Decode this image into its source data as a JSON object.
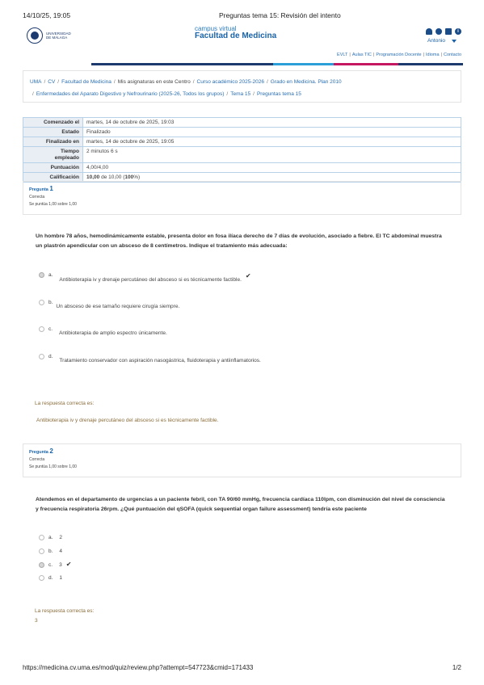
{
  "print": {
    "datetime": "14/10/25, 19:05",
    "doc_title": "Preguntas tema 15: Revisión del intento",
    "url": "https://medicina.cv.uma.es/mod/quiz/review.php?attempt=547723&cmid=171433",
    "page": "1/2"
  },
  "header": {
    "logo_text": "UNIVERSIDAD DE MÁLAGA",
    "brand_small": "campus virtual",
    "brand_big": "Facultad de Medicina",
    "user_name": "Antonio",
    "icons": [
      "bell-icon",
      "chat-icon",
      "mail-icon",
      "info-icon"
    ],
    "bar_colors": [
      "#1d3a6e",
      "#2a9fd8",
      "#c4175f"
    ]
  },
  "top_links": [
    "EVLT",
    "Aulas TIC",
    "Programación Docente",
    "Idioma",
    "Contacto"
  ],
  "breadcrumb": {
    "row1": [
      "UMA",
      "CV",
      "Facultad de Medicina",
      "Mis asignaturas en este Centro",
      "Curso académico 2025-2026",
      "Grado en Medicina. Plan 2010"
    ],
    "row2": [
      "Enfermedades del Aparato Digestivo y Nefrourinario (2025-26, Todos los grupos)",
      "Tema 15",
      "Preguntas tema 15"
    ]
  },
  "summary": [
    {
      "key": "Comenzado el",
      "value": "martes, 14 de octubre de 2025, 19:03"
    },
    {
      "key": "Estado",
      "value": "Finalizado"
    },
    {
      "key": "Finalizado en",
      "value": "martes, 14 de octubre de 2025, 19:05"
    },
    {
      "key": "Tiempo empleado",
      "value": "2 minutos 6 s"
    },
    {
      "key": "Puntuación",
      "value": "4,00/4,00"
    },
    {
      "key": "Calificación",
      "value_bold1": "10,00",
      "value_mid": " de 10,00 (",
      "value_bold2": "100",
      "value_end": "%)"
    }
  ],
  "questions": [
    {
      "label": "Pregunta",
      "number": "1",
      "state": "Correcta",
      "grade": "Se puntúa 1,00 sobre 1,00",
      "text": "Un hombre 78 años, hemodinámicamente estable, presenta dolor en fosa ilíaca derecho de 7 días de evolución, asociado a fiebre. El TC abdominal muestra un plastrón apendicular con un absceso de 8 centímetros. Indique el tratamiento más adecuada:",
      "options": [
        {
          "letter": "a.",
          "text": "Antibioterapia iv y drenaje percutáneo del absceso si es técnicamente factible.",
          "checked": true
        },
        {
          "letter": "b.",
          "text": "Un absceso de ese tamaño requiere cirugía siempre.",
          "checked": false
        },
        {
          "letter": "c.",
          "text": "Antibioterapia de amplio espectro únicamente.",
          "checked": false
        },
        {
          "letter": "d.",
          "text": "Tratamiento conservador con aspiración nasogástrica, fluidoterapia y antiinflamatorios.",
          "checked": false
        }
      ],
      "feedback_label": "La respuesta correcta es:",
      "feedback_value": "Antibioterapia iv y drenaje percutáneo del absceso si es técnicamente factible."
    },
    {
      "label": "Pregunta",
      "number": "2",
      "state": "Correcta",
      "grade": "Se puntúa 1,00 sobre 1,00",
      "text": "Atendemos en el departamento de urgencias a un paciente febril, con TA 90/60 mmHg, frecuencia cardíaca 110lpm, con disminución del nivel de consciencia y frecuencia respiratoria 26rpm. ¿Qué puntuación del qSOFA (quick sequential organ failure assessment) tendría este paciente",
      "options": [
        {
          "letter": "a.",
          "text": "2",
          "checked": false
        },
        {
          "letter": "b.",
          "text": "4",
          "checked": false
        },
        {
          "letter": "c.",
          "text": "3",
          "checked": true
        },
        {
          "letter": "d.",
          "text": "1",
          "checked": false
        }
      ],
      "feedback_label": "La respuesta correcta es:",
      "feedback_value": "3"
    }
  ]
}
